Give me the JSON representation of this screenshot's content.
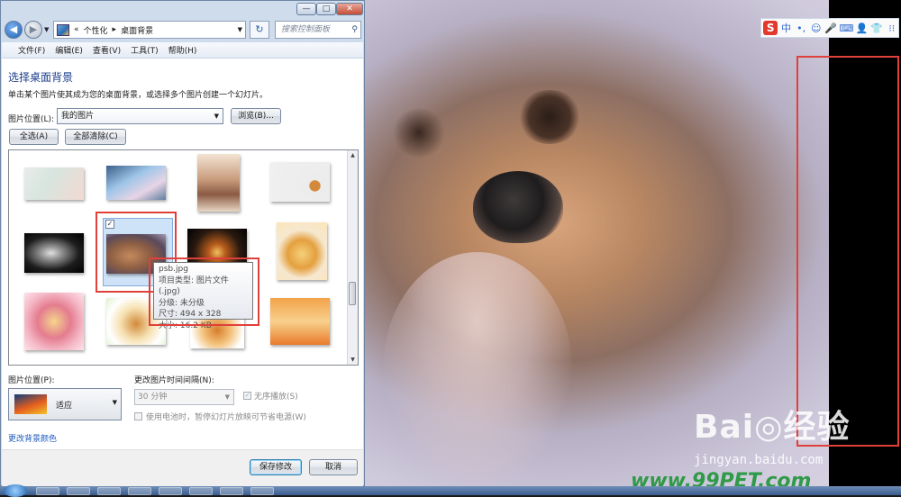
{
  "window": {
    "minimize_glyph": "—",
    "maximize_glyph": "□",
    "close_glyph": "✕",
    "address": {
      "prefix": "«",
      "crumb1": "个性化",
      "sep": "▸",
      "crumb2": "桌面背景"
    },
    "search_placeholder": "搜索控制面板",
    "menu": [
      "文件(F)",
      "编辑(E)",
      "查看(V)",
      "工具(T)",
      "帮助(H)"
    ]
  },
  "content": {
    "heading": "选择桌面背景",
    "description": "单击某个图片使其成为您的桌面背景，或选择多个图片创建一个幻灯片。",
    "picture_location_label": "图片位置(L):",
    "picture_location_value": "我的图片",
    "browse_label": "浏览(B)...",
    "select_all_label": "全选(A)",
    "clear_all_label": "全部清除(C)",
    "checkbox_mark": "✓",
    "tooltip": {
      "filename": "psb.jpg",
      "type": "项目类型: 图片文件(.jpg)",
      "rating": "分级: 未分级",
      "size": "尺寸: 494 x 328",
      "filesize": "大小: 16.2 KB"
    },
    "picture_position_label": "图片位置(P):",
    "picture_position_value": "适应",
    "interval_label": "更改图片时间间隔(N):",
    "interval_value": "30 分钟",
    "shuffle_label": "无序播放(S)",
    "battery_label": "使用电池时，暂停幻灯片放映可节省电源(W)",
    "bg_color_link": "更改背景颜色",
    "save_label": "保存修改",
    "cancel_label": "取消"
  },
  "desktop": {
    "watermark_brand": "Bai◎经验",
    "watermark_url": "jingyan.baidu.com",
    "watermark_site": "www.99PET.com",
    "ime_logo": "S",
    "ime_items": [
      "中",
      "•,",
      "☺",
      "🎤",
      "⌨",
      "👤",
      "👕",
      "⁝⁝"
    ]
  },
  "colors": {
    "highlight": "#e0403a",
    "link": "#1f5bbd",
    "heading": "#1d3f8a"
  }
}
